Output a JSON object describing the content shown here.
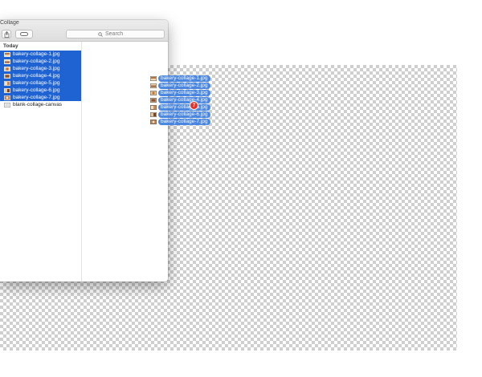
{
  "window": {
    "title": "Collage"
  },
  "toolbar": {
    "share_icon": "share-icon",
    "tag_icon": "tag-icon",
    "search_placeholder": "Search",
    "search_icon": "magnifier-icon"
  },
  "sidebar": {
    "section_label": "Today",
    "files": [
      {
        "name": "bakery-collage-1.jpg",
        "selected": true,
        "icon": "jpeg-thumbnail-icon"
      },
      {
        "name": "bakery-collage-2.jpg",
        "selected": true,
        "icon": "jpeg-thumbnail-icon"
      },
      {
        "name": "bakery-collage-3.jpg",
        "selected": true,
        "icon": "jpeg-thumbnail-icon"
      },
      {
        "name": "bakery-collage-4.jpg",
        "selected": true,
        "icon": "jpeg-thumbnail-icon"
      },
      {
        "name": "bakery-collage-5.jpg",
        "selected": true,
        "icon": "jpeg-thumbnail-icon"
      },
      {
        "name": "bakery-collage-6.jpg",
        "selected": true,
        "icon": "jpeg-thumbnail-icon"
      },
      {
        "name": "bakery-collage-7.jpg",
        "selected": true,
        "icon": "jpeg-thumbnail-icon"
      },
      {
        "name": "blank-collage-canvas",
        "selected": false,
        "icon": "canvas-document-icon"
      }
    ]
  },
  "drag_preview": {
    "items": [
      "bakery-collage-1.jpg",
      "bakery-collage-2.jpg",
      "bakery-collage-3.jpg",
      "bakery-collage-4.jpg",
      "bakery-collage-5.jpg",
      "bakery-collage-6.jpg",
      "bakery-collage-7.jpg"
    ],
    "count": "7"
  },
  "colors": {
    "selection": "#1f63d3",
    "drag_label": "#3d7fe0",
    "badge": "#e5332a"
  }
}
